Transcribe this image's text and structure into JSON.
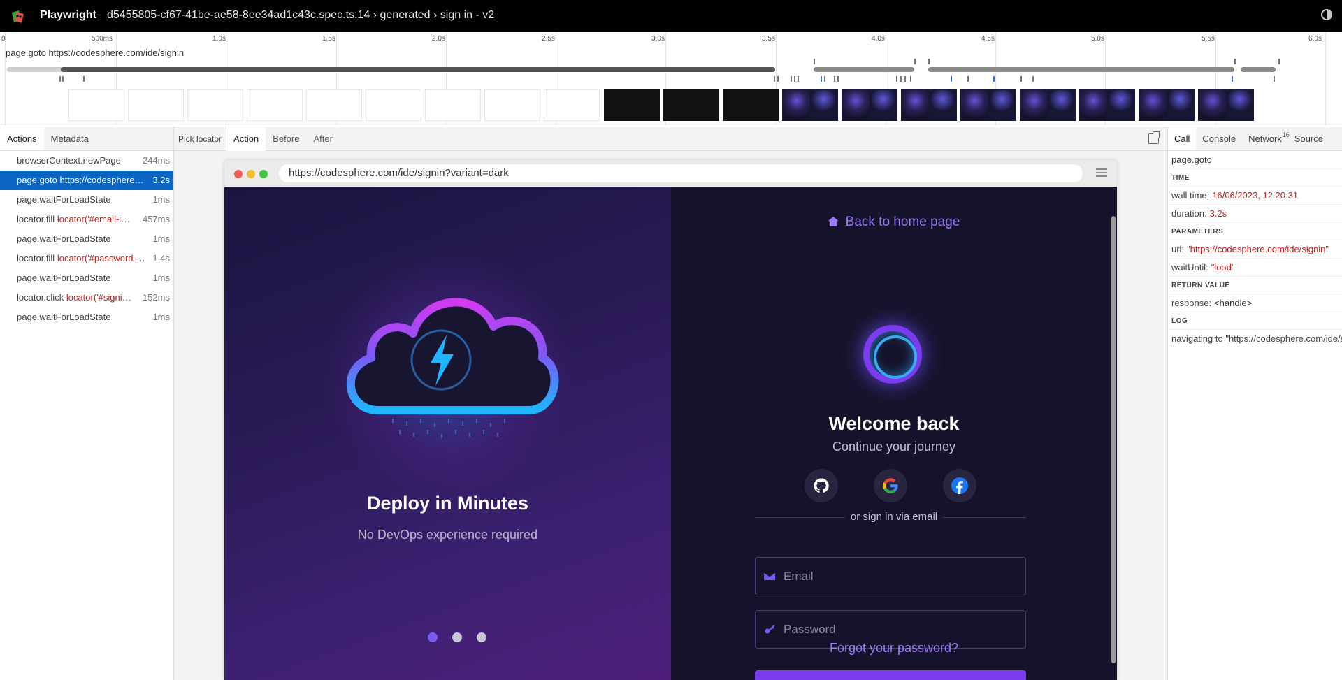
{
  "titlebar": {
    "app_name": "Playwright",
    "spec_title": "d5455805-cf67-41be-ae58-8ee34ad1c43c.spec.ts:14 › generated › sign in - v2"
  },
  "timeline": {
    "ticks": [
      "0",
      "500ms",
      "1.0s",
      "1.5s",
      "2.0s",
      "2.5s",
      "3.0s",
      "3.5s",
      "4.0s",
      "4.5s",
      "5.0s",
      "5.5s",
      "6.0s"
    ],
    "hover_label": "page.goto https://codesphere.com/ide/signin"
  },
  "left_panel": {
    "tabs": [
      "Actions",
      "Metadata"
    ],
    "actions": [
      {
        "name": "browserContext.newPage",
        "arg": "",
        "duration": "244ms"
      },
      {
        "name": "page.goto",
        "arg": "https://codesphere.com/ide/signin",
        "duration": "3.2s"
      },
      {
        "name": "page.waitForLoadState",
        "arg": "",
        "duration": "1ms"
      },
      {
        "name": "locator.fill",
        "arg": "locator('#email-input')",
        "duration": "457ms"
      },
      {
        "name": "page.waitForLoadState",
        "arg": "",
        "duration": "1ms"
      },
      {
        "name": "locator.fill",
        "arg": "locator('#password-input')",
        "duration": "1.4s"
      },
      {
        "name": "page.waitForLoadState",
        "arg": "",
        "duration": "1ms"
      },
      {
        "name": "locator.click",
        "arg": "locator('#signin-button')",
        "duration": "152ms"
      },
      {
        "name": "page.waitForLoadState",
        "arg": "",
        "duration": "1ms"
      }
    ]
  },
  "middle": {
    "pick_locator": "Pick locator",
    "tabs": [
      "Action",
      "Before",
      "After"
    ],
    "url": "https://codesphere.com/ide/signin?variant=dark",
    "promo": {
      "title": "Deploy in Minutes",
      "subtitle": "No DevOps experience required"
    },
    "signin": {
      "back_link": "Back to home page",
      "welcome": "Welcome back",
      "continue": "Continue your journey",
      "or_text": "or sign in via email",
      "email_placeholder": "Email",
      "password_placeholder": "Password",
      "forgot": "Forgot your password?"
    }
  },
  "right_panel": {
    "tabs": [
      "Call",
      "Console",
      "Network",
      "Source"
    ],
    "network_count": "16",
    "call_title": "page.goto",
    "time_head": "TIME",
    "wall_time_label": "wall time:",
    "wall_time": "16/06/2023, 12:20:31",
    "duration_label": "duration:",
    "duration": "3.2s",
    "params_head": "PARAMETERS",
    "url_label": "url:",
    "url_value": "\"https://codesphere.com/ide/signin\"",
    "wait_label": "waitUntil:",
    "wait_value": "\"load\"",
    "return_head": "RETURN VALUE",
    "response_label": "response:",
    "response_value": "<handle>",
    "log_head": "LOG",
    "log_line": "navigating to \"https://codesphere.com/ide/signin\", waiting until \"load\""
  },
  "colors": {
    "selected_row": "#0b66c3",
    "accent_purple": "#7b3cf0",
    "link_purple": "#9d7bfa",
    "error_red": "#c5221f"
  }
}
